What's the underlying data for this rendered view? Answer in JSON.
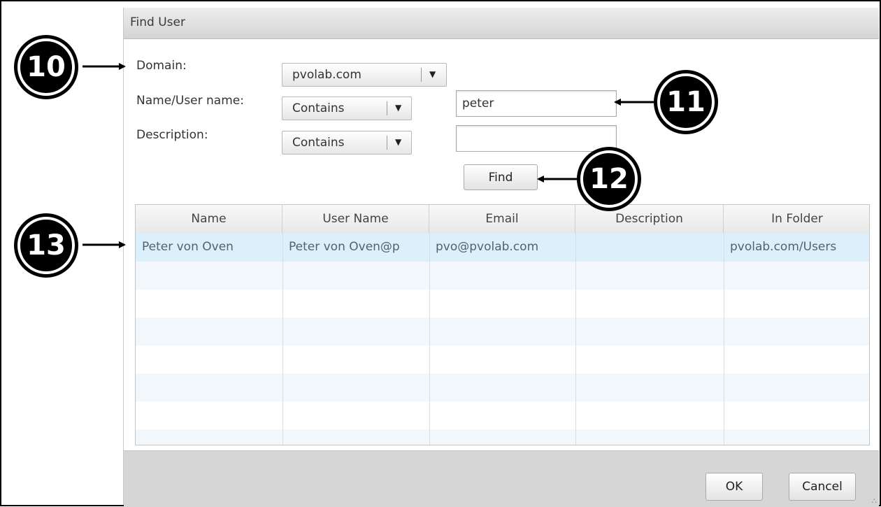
{
  "dialog": {
    "title": "Find User"
  },
  "form": {
    "domain_label": "Domain:",
    "domain_value": "pvolab.com",
    "name_label": "Name/User name:",
    "name_match": "Contains",
    "name_value": "peter",
    "description_label": "Description:",
    "description_match": "Contains",
    "description_value": "",
    "find_label": "Find"
  },
  "table": {
    "columns": [
      "Name",
      "User Name",
      "Email",
      "Description",
      "In Folder"
    ],
    "rows": [
      [
        "Peter von Oven",
        "Peter von Oven@p",
        "pvo@pvolab.com",
        "",
        "pvolab.com/Users"
      ]
    ]
  },
  "footer": {
    "ok_label": "OK",
    "cancel_label": "Cancel"
  },
  "callouts": {
    "domain": "10",
    "name_field": "11",
    "find_button": "12",
    "results": "13"
  },
  "icons": {
    "dropdown": "chevron-down-icon",
    "resize": "resize-grip-icon",
    "arrow": "arrow-right-icon"
  },
  "colors": {
    "selected_row": "#dcf0fb",
    "alt_row": "#f2f7fb",
    "footer": "#d6d6d6"
  }
}
